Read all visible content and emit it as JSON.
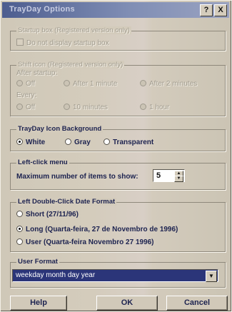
{
  "window": {
    "title": "TrayDay Options",
    "help_glyph": "?",
    "close_glyph": "X"
  },
  "startup": {
    "legend": "Startup box (Registered version only)",
    "checkbox_label": "Do not display startup box"
  },
  "shift_icon": {
    "legend": "Shift icon (Registered version only)",
    "after_label": "After startup:",
    "after_options": [
      "Off",
      "After 1 minute",
      "After 2 minutes"
    ],
    "every_label": "Every:",
    "every_options": [
      "Off",
      "10 minutes",
      "1 hour"
    ]
  },
  "background": {
    "legend": "TrayDay Icon Background",
    "options": [
      "White",
      "Gray",
      "Transparent"
    ],
    "selected": "White"
  },
  "left_click": {
    "legend": "Left-click menu",
    "max_label": "Maximum number of items to show:",
    "max_value": "5"
  },
  "date_format": {
    "legend": "Left Double-Click Date Format",
    "options": [
      "Short (27/11/96)",
      "Long (Quarta-feira, 27 de Novembro  de 1996)",
      "User (Quarta-feira Novembro 27 1996)"
    ],
    "selected": "Long (Quarta-feira, 27 de Novembro  de 1996)"
  },
  "user_format": {
    "legend": "User Format",
    "value": "weekday month day year"
  },
  "buttons": {
    "help": "Help",
    "ok": "OK",
    "cancel": "Cancel"
  }
}
